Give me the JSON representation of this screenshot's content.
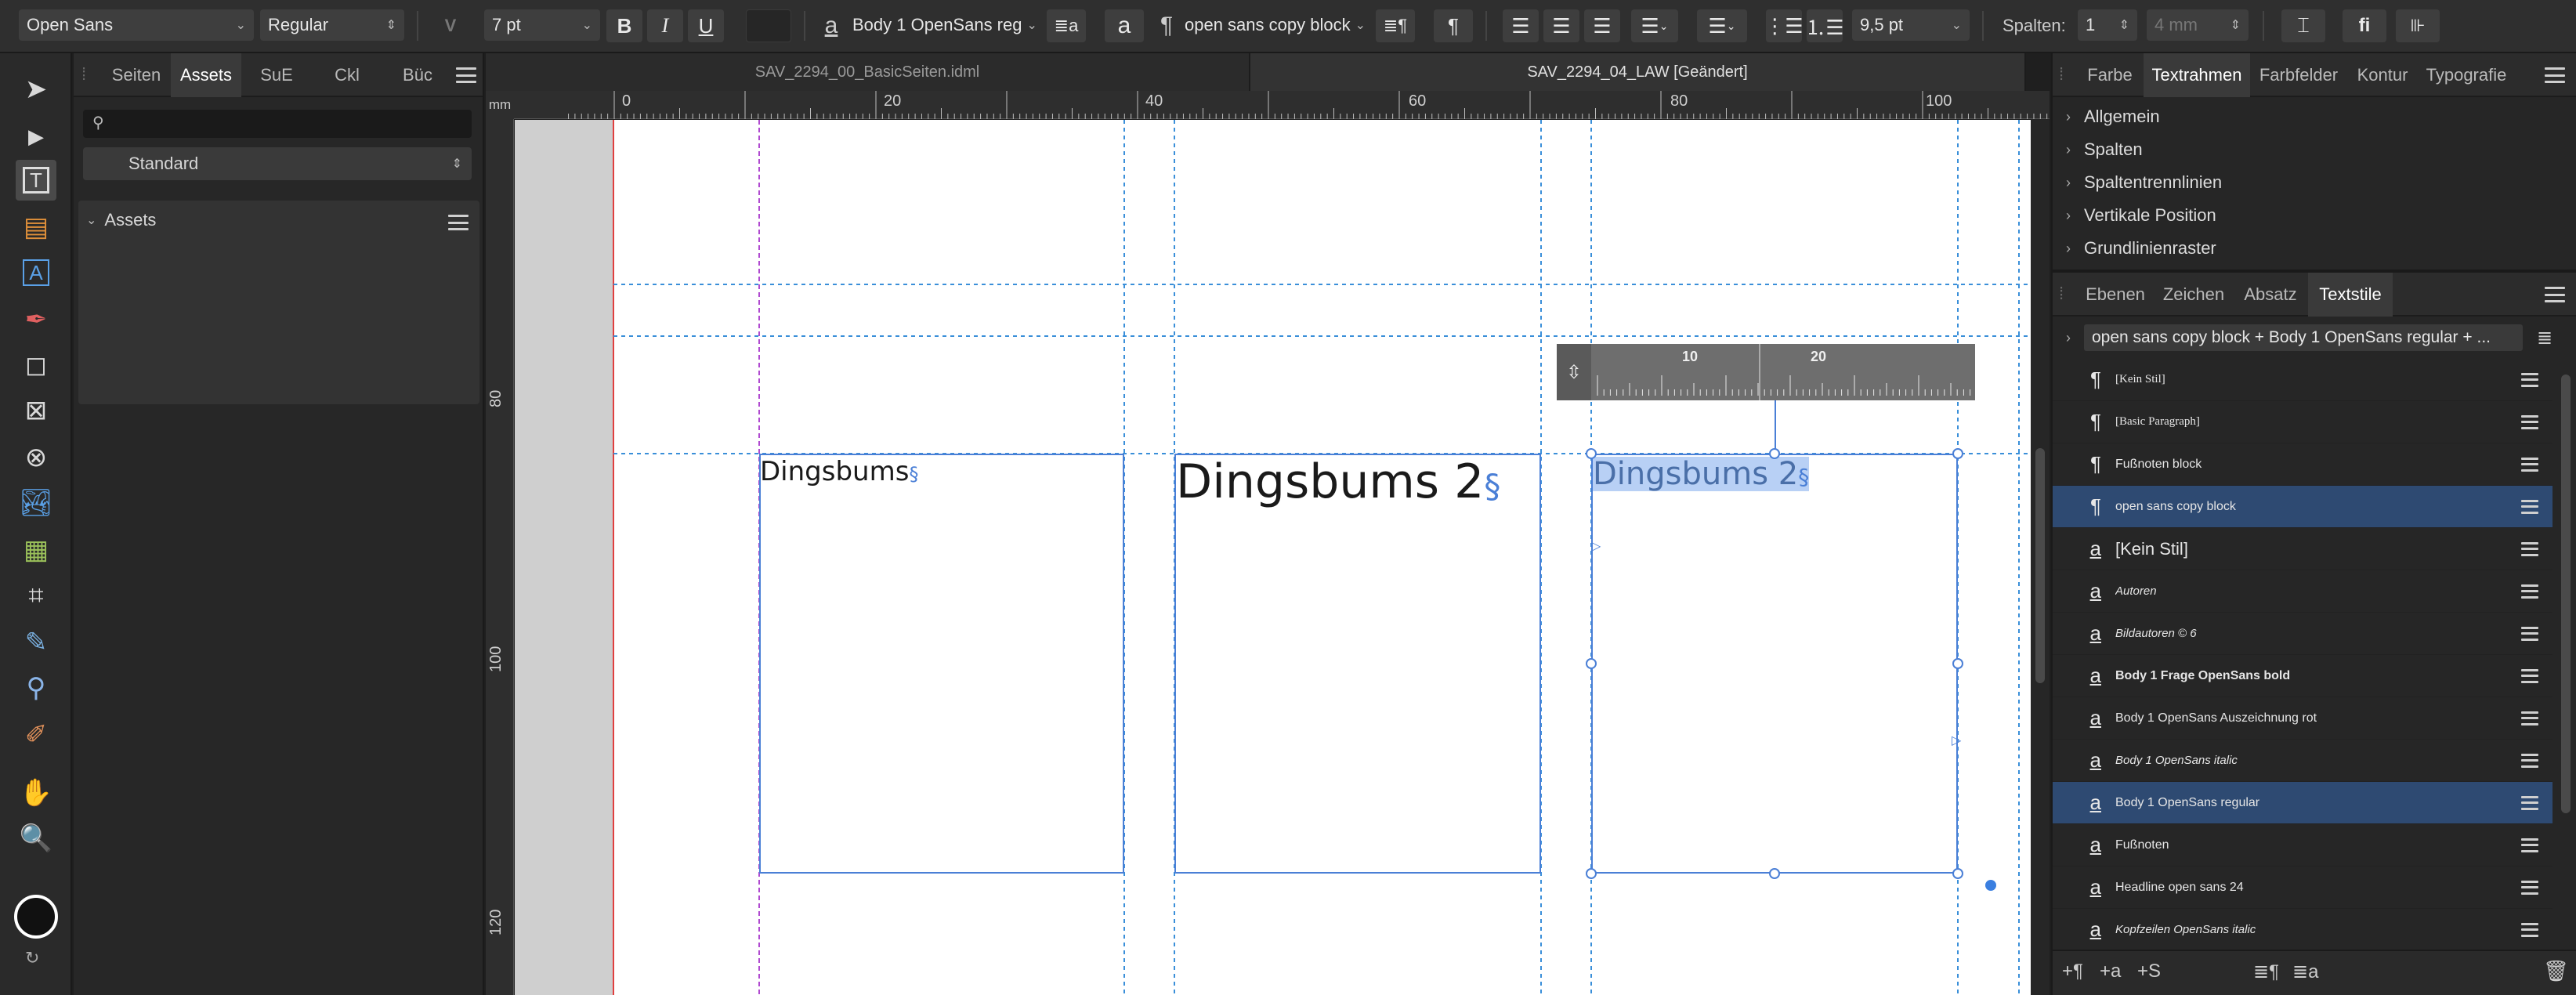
{
  "toolbar": {
    "font_family": "Open Sans",
    "font_style": "Regular",
    "kerning_label": "V",
    "font_size": "7 pt",
    "bold": "B",
    "italic": "I",
    "underline": "U",
    "char_style": "Body 1 OpenSans reg",
    "para_style": "open sans copy block",
    "leading": "9,5 pt",
    "columns_label": "Spalten:",
    "columns_value": "1",
    "gutter_value": "4 mm",
    "ligature_label": "fi"
  },
  "tools": [
    "move-tool",
    "node-tool",
    "frame-text-tool",
    "table-tool",
    "artistic-text-tool",
    "pen-tool",
    "rectangle-tool",
    "picture-frame-tool",
    "ellipse-frame-tool",
    "place-image-tool",
    "place-document-tool",
    "crop-tool",
    "fill-tool",
    "transparency-tool",
    "color-picker-tool",
    "hand-tool",
    "zoom-tool"
  ],
  "left_panel": {
    "tabs": [
      "Seiten",
      "Assets",
      "SuE",
      "Ckl",
      "Büc"
    ],
    "active_tab": "Assets",
    "search_placeholder": "",
    "dropdown": "Standard",
    "group_title": "Assets"
  },
  "document": {
    "tabs": [
      "SAV_2294_00_BasicSeiten.idml",
      "SAV_2294_04_LAW [Geändert]"
    ],
    "ruler_unit": "mm",
    "hruler_labels": [
      "0",
      "20",
      "40",
      "60",
      "80",
      "100"
    ],
    "vruler_labels": [
      "80",
      "100",
      "120"
    ],
    "frame1_text": "Dingsbums",
    "frame2_text": "Dingsbums 2",
    "frame3_text": "Dingsbums 2",
    "section_mark": "§",
    "tab_ruler_labels": [
      "10",
      "20"
    ]
  },
  "right_panel": {
    "tabs_top": [
      "Farbe",
      "Textrahmen",
      "Farbfelder",
      "Kontur",
      "Typografie"
    ],
    "active_top": "Textrahmen",
    "sections": [
      "Allgemein",
      "Spalten",
      "Spaltentrennlinien",
      "Vertikale Position",
      "Grundlinienraster"
    ],
    "tabs_bottom": [
      "Ebenen",
      "Zeichen",
      "Absatz",
      "Textstile"
    ],
    "active_bottom": "Textstile",
    "style_summary": "open sans copy block + Body 1 OpenSans regular + ...",
    "styles": [
      {
        "glyph": "¶",
        "name": "[Kein Stil]",
        "font": "serif-small",
        "selected": false
      },
      {
        "glyph": "¶",
        "name": "[Basic Paragraph]",
        "font": "serif-small",
        "selected": false
      },
      {
        "glyph": "¶",
        "name": "Fußnoten block",
        "font": "sans-small",
        "selected": false
      },
      {
        "glyph": "¶",
        "name": "open sans copy block",
        "font": "sans-small",
        "selected": true
      },
      {
        "glyph": "a",
        "name": "[Kein Stil]",
        "font": "sans-regular",
        "selected": false
      },
      {
        "glyph": "a",
        "name": "Autoren",
        "font": "italic-small",
        "selected": false
      },
      {
        "glyph": "a",
        "name": "Bildautoren © 6",
        "font": "italic-small",
        "selected": false
      },
      {
        "glyph": "a",
        "name": "Body 1 Frage OpenSans bold",
        "font": "bold-small",
        "selected": false
      },
      {
        "glyph": "a",
        "name": "Body 1 OpenSans Auszeichnung rot",
        "font": "sans-small",
        "selected": false
      },
      {
        "glyph": "a",
        "name": "Body 1 OpenSans italic",
        "font": "italic-small",
        "selected": false
      },
      {
        "glyph": "a",
        "name": "Body 1 OpenSans regular",
        "font": "sans-small",
        "selected": true
      },
      {
        "glyph": "a",
        "name": "Fußnoten",
        "font": "sans-small",
        "selected": false
      },
      {
        "glyph": "a",
        "name": "Headline open sans 24",
        "font": "sans-small",
        "selected": false
      },
      {
        "glyph": "a",
        "name": "Kopfzeilen OpenSans italic",
        "font": "italic-small",
        "selected": false
      }
    ],
    "bottom_icons": [
      "+¶",
      "+a",
      "+S"
    ]
  },
  "colors": {
    "selection": "#2e4a72",
    "frame": "#4a7fd6",
    "guide": "#3a8fd9",
    "margin_red": "#e04040",
    "text_highlight": "#b8d0f5"
  }
}
